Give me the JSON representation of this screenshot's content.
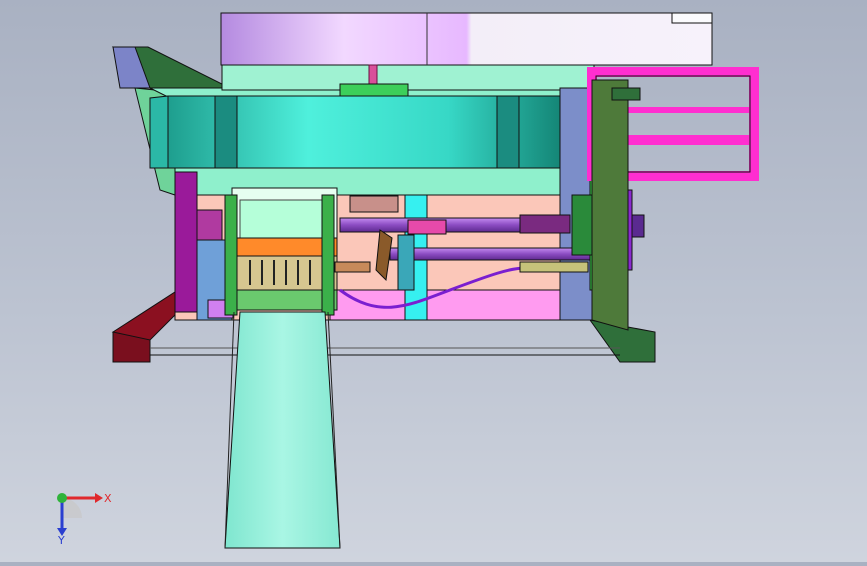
{
  "viewport": {
    "background_top": "#a9b1c2",
    "background_bottom": "#cfd4de"
  },
  "triad": {
    "x_label": "X",
    "y_label": "Y",
    "x_color": "#e0282c",
    "y_color": "#2fb33a",
    "z_color": "#2a3fd0"
  },
  "model": {
    "colors": {
      "top_panel": "#d9a8f0",
      "hopper": "#9fe8c8",
      "drum": "#35d6c0",
      "frame_dark": "#2f6f3a",
      "magenta_frame": "#ff3fd6",
      "chute": "#8ff0d8",
      "shaft": "#9b5fd0",
      "red_bar": "#8b1020"
    }
  }
}
